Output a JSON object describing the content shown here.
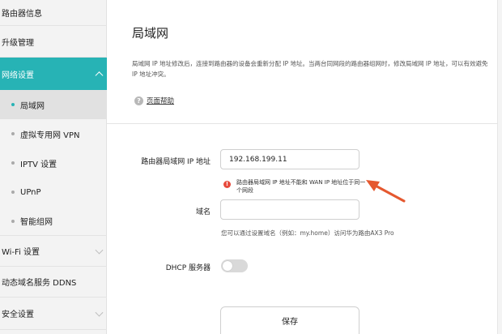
{
  "sidebar": {
    "items": [
      {
        "label": "路由器信息"
      },
      {
        "label": "升级管理"
      },
      {
        "label": "网络设置"
      },
      {
        "label": "局域网"
      },
      {
        "label": "虚拟专用网 VPN"
      },
      {
        "label": "IPTV 设置"
      },
      {
        "label": "UPnP"
      },
      {
        "label": "智能组网"
      },
      {
        "label": "Wi-Fi 设置"
      },
      {
        "label": "动态域名服务 DDNS"
      },
      {
        "label": "安全设置"
      }
    ]
  },
  "main": {
    "title": "局域网",
    "description": "局域网 IP 地址修改后，连接到路由器的设备会重新分配 IP 地址。当两台同网段的路由器组网时，修改局域网 IP 地址，可以有效避免 IP 地址冲突。",
    "help_link": "页面帮助",
    "lan_ip": {
      "label": "路由器局域网 IP 地址",
      "value": "192.168.199.11",
      "error": "路由器局域网 IP 地址不能和 WAN IP 地址位于同一个网段",
      "error_icon": "exclamation-icon"
    },
    "domain": {
      "label": "域名",
      "value": "",
      "hint": "您可以通过设置域名（例如：my.home）访问华为路由AX3 Pro"
    },
    "dhcp": {
      "label": "DHCP 服务器",
      "enabled": false
    },
    "save_label": "保存"
  },
  "colors": {
    "accent": "#27b3b5",
    "error": "#e74a3c",
    "annotation_arrow": "#e5582f"
  }
}
